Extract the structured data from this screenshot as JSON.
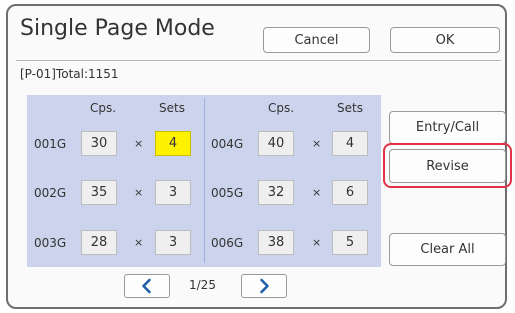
{
  "title": "Single Page Mode",
  "buttons": {
    "cancel": "Cancel",
    "ok": "OK",
    "entry_call": "Entry/Call",
    "revise": "Revise",
    "clear_all": "Clear All"
  },
  "job_info": "[P-01]Total:1151",
  "headers": {
    "copies": "Cps.",
    "sets": "Sets"
  },
  "multiply_sign": "×",
  "groups_left": [
    {
      "id": "001G",
      "copies": "30",
      "sets": "4",
      "selected": true
    },
    {
      "id": "002G",
      "copies": "35",
      "sets": "3"
    },
    {
      "id": "003G",
      "copies": "28",
      "sets": "3"
    }
  ],
  "groups_right": [
    {
      "id": "004G",
      "copies": "40",
      "sets": "4"
    },
    {
      "id": "005G",
      "copies": "32",
      "sets": "6"
    },
    {
      "id": "006G",
      "copies": "38",
      "sets": "5"
    }
  ],
  "pagination": {
    "current": "1/25"
  },
  "icons": {
    "prev": "chevron-left-icon",
    "next": "chevron-right-icon"
  },
  "colors": {
    "selection": "#fff200",
    "highlight_ring": "#e23245",
    "arrow": "#1f5fa8",
    "panel": "#cbd4ec"
  }
}
